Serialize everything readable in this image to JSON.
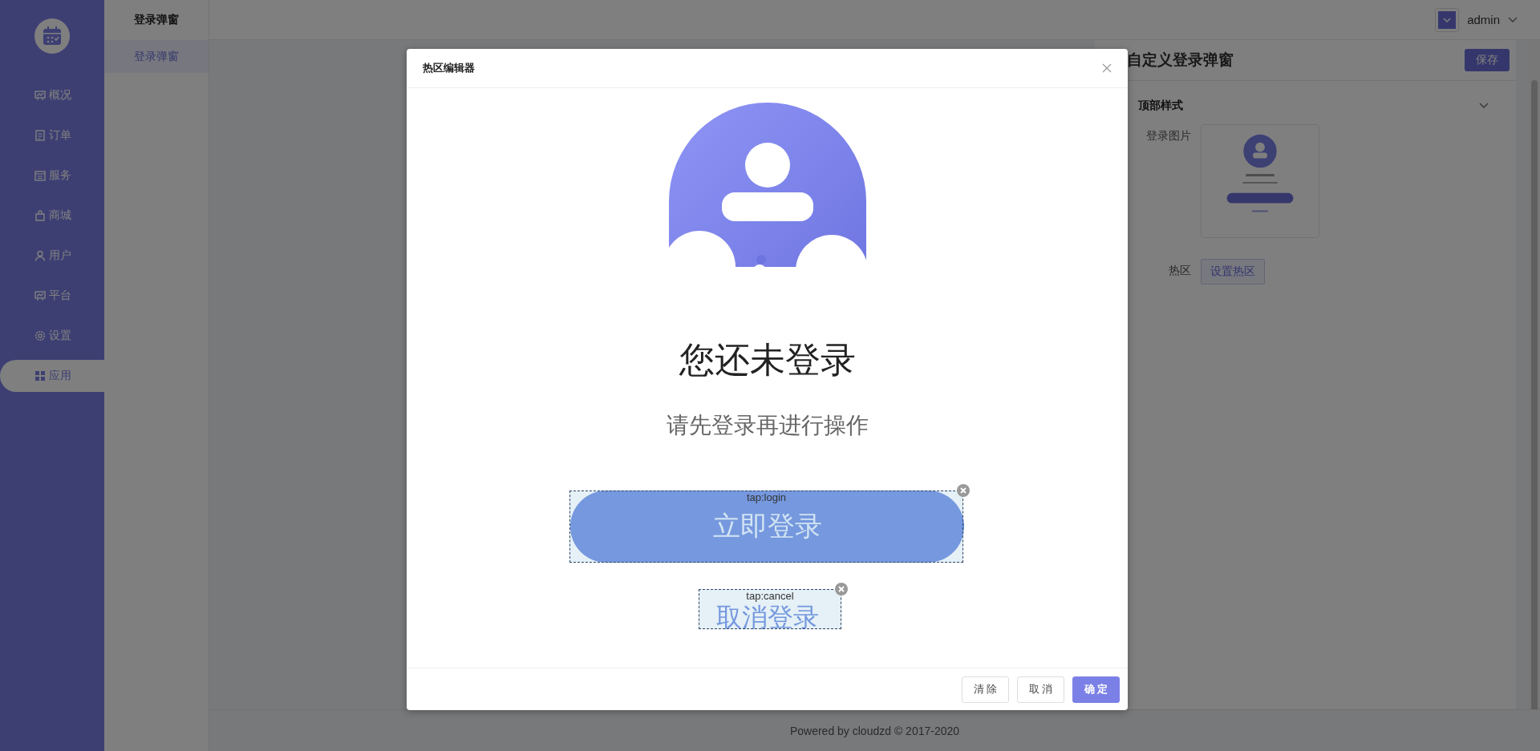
{
  "sidebar": {
    "items": [
      {
        "label": "概况",
        "selected": false
      },
      {
        "label": "订单",
        "selected": false
      },
      {
        "label": "服务",
        "selected": false
      },
      {
        "label": "商城",
        "selected": false
      },
      {
        "label": "用户",
        "selected": false
      },
      {
        "label": "平台",
        "selected": false
      },
      {
        "label": "设置",
        "selected": false
      },
      {
        "label": "应用",
        "selected": true
      }
    ]
  },
  "submenu": {
    "title": "登录弹窗",
    "items": [
      {
        "label": "登录弹窗",
        "selected": true
      }
    ]
  },
  "header": {
    "user": "admin"
  },
  "panel": {
    "title": "自定义登录弹窗",
    "save_button": "保存",
    "section": {
      "title": "顶部样式",
      "expanded": true
    },
    "image_label": "登录图片",
    "hotspot_label": "热区",
    "hotspot_button": "设置热区"
  },
  "footer": "Powered by cloudzd © 2017-2020",
  "modal": {
    "title": "热区编辑器",
    "image": {
      "heading": "您还未登录",
      "subheading": "请先登录再进行操作",
      "login_button": "立即登录",
      "cancel_button": "取消登录"
    },
    "hotspots": [
      {
        "label": "tap:login"
      },
      {
        "label": "tap:cancel"
      }
    ],
    "buttons": [
      {
        "label": "清除",
        "kind": "plain"
      },
      {
        "label": "取消",
        "kind": "plain"
      },
      {
        "label": "确定",
        "kind": "primary"
      }
    ]
  }
}
